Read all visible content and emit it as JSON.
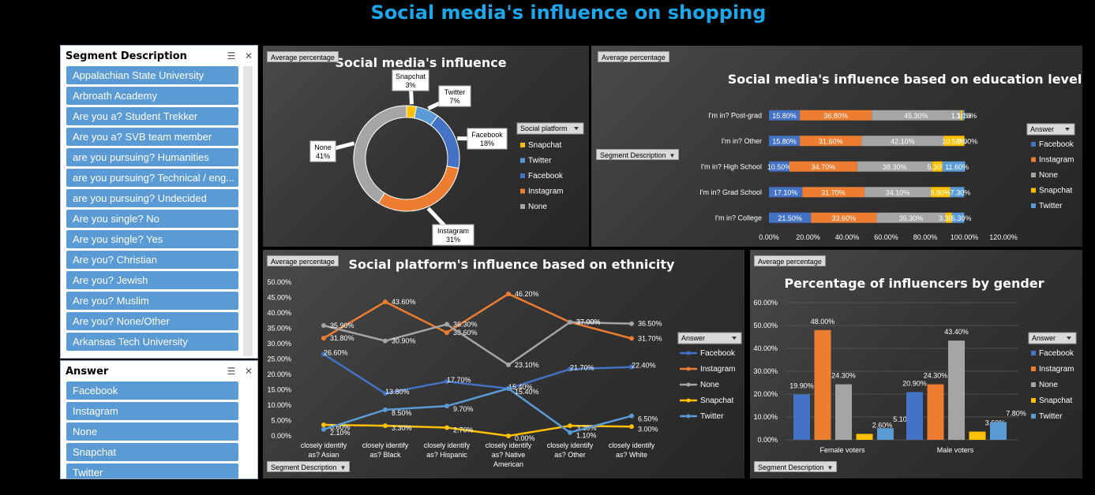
{
  "title": "Social media's influence on shopping",
  "field_buttons": {
    "avg": "Average percentage",
    "segment": "Segment Description",
    "social_platform": "Social platform",
    "answer": "Answer"
  },
  "slicer_segment": {
    "title": "Segment Description",
    "items": [
      "Appalachian State University",
      "Arbroath Academy",
      "Are you a? Student Trekker",
      "Are you a? SVB team member",
      "are you pursuing? Humanities",
      "are you pursuing? Technical / eng...",
      "are you pursuing? Undecided",
      "Are you single? No",
      "Are you single? Yes",
      "Are you? Christian",
      "Are you? Jewish",
      "Are you? Muslim",
      "Are you? None/Other",
      "Arkansas Tech University"
    ]
  },
  "slicer_answer": {
    "title": "Answer",
    "items": [
      "Facebook",
      "Instagram",
      "None",
      "Snapchat",
      "Twitter"
    ]
  },
  "colors": {
    "Facebook": "#4472c4",
    "Instagram": "#ed7d31",
    "None": "#a5a5a5",
    "Snapchat": "#ffc000",
    "Twitter": "#5b9bd5"
  },
  "chart_data": [
    {
      "type": "pie",
      "title": "Social media's influence",
      "legend_title": "Social platform",
      "legend": [
        "Snapchat",
        "Twitter",
        "Facebook",
        "Instagram",
        "None"
      ],
      "slices": [
        {
          "name": "Snapchat",
          "value": 3,
          "label": "3%"
        },
        {
          "name": "Twitter",
          "value": 7,
          "label": "7%"
        },
        {
          "name": "Facebook",
          "value": 18,
          "label": "18%"
        },
        {
          "name": "Instagram",
          "value": 31,
          "label": "31%"
        },
        {
          "name": "None",
          "value": 41,
          "label": "41%"
        }
      ]
    },
    {
      "type": "bar",
      "orientation": "horizontal-stacked",
      "title": "Social media's influence based on education level",
      "legend_title": "Answer",
      "legend": [
        "Facebook",
        "Instagram",
        "None",
        "Snapchat",
        "Twitter"
      ],
      "categories": [
        "I'm in? Post-grad",
        "I'm in? Other",
        "I'm in? High School",
        "I'm in? Grad School",
        "I'm in? College"
      ],
      "series": [
        {
          "name": "Facebook",
          "values": [
            15.8,
            15.8,
            10.5,
            17.1,
            21.5
          ]
        },
        {
          "name": "Instagram",
          "values": [
            36.8,
            31.6,
            34.7,
            31.7,
            33.6
          ]
        },
        {
          "name": "None",
          "values": [
            45.3,
            42.1,
            38.3,
            34.1,
            35.3
          ]
        },
        {
          "name": "Snapchat",
          "values": [
            1.1,
            10.5,
            5.3,
            9.8,
            3.3
          ]
        },
        {
          "name": "Twitter",
          "values": [
            1.1,
            0.0,
            11.6,
            7.3,
            6.3
          ]
        }
      ],
      "data_labels": [
        [
          "15.80%",
          "36.80%",
          "45.30%",
          "1.10%",
          "1.10%"
        ],
        [
          "15.80%",
          "31.60%",
          "42.10%",
          "10.50%",
          "0.00%"
        ],
        [
          "10.50%",
          "34.70%",
          "38.30%",
          "5.30%",
          "11.60%"
        ],
        [
          "17.10%",
          "31.70%",
          "34.10%",
          "9.80%",
          "7.30%"
        ],
        [
          "21.50%",
          "33.60%",
          "35.30%",
          "3.30%",
          "6.30%"
        ]
      ],
      "xlim": [
        0,
        120
      ],
      "x_ticks": [
        "0.00%",
        "20.00%",
        "40.00%",
        "60.00%",
        "80.00%",
        "100.00%",
        "120.00%"
      ]
    },
    {
      "type": "line",
      "title": "Social platform's influence based on ethnicity",
      "legend_title": "Answer",
      "categories": [
        "closely identify as? Asian",
        "closely identify as? Black",
        "closely identify as? Hispanic",
        "closely identify as? Native American",
        "closely identify as? Other",
        "closely identify as? White"
      ],
      "category_lines": [
        [
          "closely identify",
          "as? Asian"
        ],
        [
          "closely identify",
          "as? Black"
        ],
        [
          "closely identify",
          "as? Hispanic"
        ],
        [
          "closely identify",
          "as? Native",
          "American"
        ],
        [
          "closely identify",
          "as? Other"
        ],
        [
          "closely identify",
          "as? White"
        ]
      ],
      "series": [
        {
          "name": "Facebook",
          "values": [
            26.6,
            13.8,
            17.7,
            15.4,
            21.7,
            22.4
          ],
          "labels": [
            "26.60%",
            "13.80%",
            "17.70%",
            "15.40%",
            "21.70%",
            "22.40%"
          ]
        },
        {
          "name": "Instagram",
          "values": [
            31.8,
            43.6,
            33.6,
            46.2,
            37.0,
            31.7
          ],
          "labels": [
            "31.80%",
            "43.60%",
            "33.60%",
            "46.20%",
            "37.00%",
            "31.70%"
          ]
        },
        {
          "name": "None",
          "values": [
            35.9,
            30.9,
            36.3,
            23.1,
            37.0,
            36.5
          ],
          "labels": [
            "35.90%",
            "30.90%",
            "36.30%",
            "23.10%",
            "37.00%",
            "36.50%"
          ]
        },
        {
          "name": "Snapchat",
          "values": [
            3.6,
            3.3,
            2.7,
            0.0,
            3.3,
            3.0
          ],
          "labels": [
            "3.60%",
            "3.30%",
            "2.70%",
            "0.00%",
            "3.30%",
            "3.00%"
          ]
        },
        {
          "name": "Twitter",
          "values": [
            2.1,
            8.5,
            9.7,
            15.4,
            1.1,
            6.5
          ],
          "labels": [
            "2.10%",
            "8.50%",
            "9.70%",
            "15.40%",
            "1.10%",
            "6.50%"
          ]
        }
      ],
      "ylim": [
        0,
        50
      ],
      "y_ticks": [
        "0.00%",
        "5.00%",
        "10.00%",
        "15.00%",
        "20.00%",
        "25.00%",
        "30.00%",
        "35.00%",
        "40.00%",
        "45.00%",
        "50.00%"
      ]
    },
    {
      "type": "bar",
      "title": "Percentage of influencers by gender",
      "legend_title": "Answer",
      "categories": [
        "Female voters",
        "Male voters"
      ],
      "series": [
        {
          "name": "Facebook",
          "values": [
            19.9,
            20.9
          ],
          "labels": [
            "19.90%",
            "20.90%"
          ]
        },
        {
          "name": "Instagram",
          "values": [
            48.0,
            24.3
          ],
          "labels": [
            "48.00%",
            "24.30%"
          ]
        },
        {
          "name": "None",
          "values": [
            24.3,
            43.4
          ],
          "labels": [
            "24.30%",
            "43.40%"
          ]
        },
        {
          "name": "Snapchat",
          "values": [
            2.6,
            3.6
          ],
          "labels": [
            "2.60%",
            "3.60%"
          ]
        },
        {
          "name": "Twitter",
          "values": [
            5.1,
            7.8
          ],
          "labels": [
            "5.10%",
            "7.80%"
          ]
        }
      ],
      "ylim": [
        0,
        60
      ],
      "y_ticks": [
        "0.00%",
        "10.00%",
        "20.00%",
        "30.00%",
        "40.00%",
        "50.00%",
        "60.00%"
      ]
    }
  ]
}
